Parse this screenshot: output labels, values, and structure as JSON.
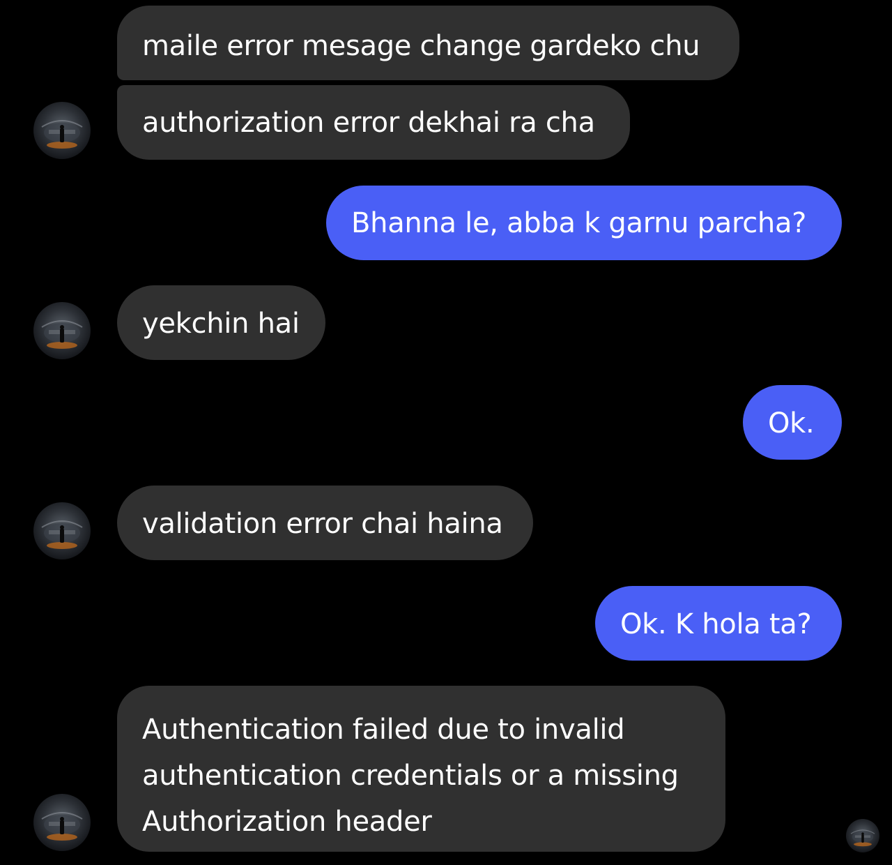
{
  "conversation": {
    "messages": [
      {
        "sender": "other",
        "text": "maile error mesage change gardeko chu"
      },
      {
        "sender": "other",
        "text": "authorization error dekhai ra cha"
      },
      {
        "sender": "me",
        "text": "Bhanna le, abba k garnu parcha?"
      },
      {
        "sender": "other",
        "text": "yekchin hai"
      },
      {
        "sender": "me",
        "text": "Ok."
      },
      {
        "sender": "other",
        "text": "validation error chai haina"
      },
      {
        "sender": "me",
        "text": "Ok. K hola ta?"
      },
      {
        "sender": "other",
        "lines": [
          "Authentication failed due to invalid",
          "authentication credentials or a missing",
          "Authorization header"
        ]
      }
    ]
  },
  "colors": {
    "background": "#000000",
    "incoming_bubble": "#303030",
    "outgoing_bubble": "#4a5ff6",
    "text": "#ffffff"
  },
  "icons": {
    "avatar": "contact-avatar-photo",
    "read_receipt": "seen-avatar-icon"
  }
}
